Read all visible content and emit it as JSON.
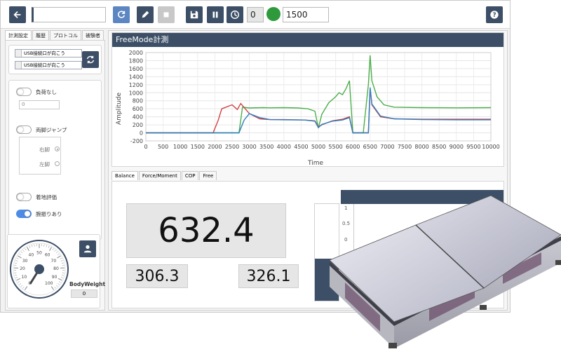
{
  "toolbar": {
    "field_value": "",
    "counter_value": "0",
    "duration_value": "1500",
    "indicator_color": "#2e9a3c"
  },
  "left_tabs": [
    "計測設定",
    "履歴",
    "プロトコル",
    "被験者"
  ],
  "usb_ports": [
    "USB接続口が向こう",
    "USB接続口が向こう"
  ],
  "settings": {
    "no_load_label": "負荷なし",
    "no_load_value": "0",
    "double_jump_label": "両脚ジャンプ",
    "right_leg_label": "右脚",
    "left_leg_label": "左脚",
    "landing_label": "着地評価",
    "arm_swing_label": "腕振りあり"
  },
  "gauge": {
    "ticks": [
      "0",
      "10",
      "20",
      "30",
      "40",
      "50",
      "60",
      "70",
      "80",
      "90",
      "100"
    ],
    "bodyweight_label": "BodyWeight",
    "bodyweight_value": "0"
  },
  "chart": {
    "title": "FreeMode計測",
    "ylabel": "Amplitude",
    "xlabel": "Time"
  },
  "chart_data": {
    "type": "line",
    "ylim": [
      -200,
      2000
    ],
    "xlim": [
      0,
      10000
    ],
    "yticks": [
      -200,
      0,
      200,
      400,
      600,
      800,
      1000,
      1200,
      1400,
      1600,
      1800,
      2000
    ],
    "xticks": [
      0,
      500,
      1000,
      1500,
      2000,
      2500,
      3000,
      3500,
      4000,
      4500,
      5000,
      5500,
      6000,
      6500,
      7000,
      7500,
      8000,
      8500,
      9000,
      9500,
      10000
    ],
    "grid": true,
    "series": [
      {
        "color": "#4cae4c",
        "x": [
          0,
          1950,
          2050,
          2200,
          2400,
          2700,
          2800,
          3000,
          3400,
          3600,
          4000,
          4400,
          4700,
          4900,
          5000,
          5100,
          5300,
          5500,
          5600,
          5700,
          5800,
          5900,
          6000,
          6100,
          6300,
          6450,
          6500,
          6550,
          6700,
          6900,
          7200,
          8000,
          9000,
          10000
        ],
        "y": [
          0,
          0,
          0,
          0,
          0,
          0,
          640,
          620,
          630,
          625,
          630,
          620,
          600,
          540,
          120,
          460,
          750,
          900,
          1000,
          950,
          1100,
          1300,
          0,
          0,
          0,
          1200,
          1930,
          1300,
          900,
          700,
          640,
          630,
          625,
          630
        ]
      },
      {
        "color": "#d04040",
        "x": [
          0,
          1950,
          2100,
          2200,
          2500,
          2650,
          2750,
          3000,
          3300,
          3600,
          4000,
          4600,
          4900,
          5000,
          5100,
          5400,
          5700,
          5900,
          6000,
          6100,
          6450,
          6500,
          6550,
          6800,
          7200,
          8000,
          9000,
          10000
        ],
        "y": [
          0,
          0,
          320,
          600,
          700,
          580,
          730,
          480,
          350,
          330,
          330,
          320,
          300,
          150,
          200,
          300,
          340,
          400,
          0,
          0,
          0,
          1100,
          700,
          400,
          350,
          340,
          340,
          340
        ]
      },
      {
        "color": "#2f7fc1",
        "x": [
          0,
          1950,
          2700,
          2850,
          3000,
          3300,
          3600,
          4000,
          4600,
          4900,
          5000,
          5100,
          5400,
          5700,
          5900,
          6000,
          6100,
          6450,
          6500,
          6550,
          6800,
          7200,
          8000,
          9000,
          10000
        ],
        "y": [
          0,
          0,
          0,
          320,
          480,
          380,
          330,
          325,
          320,
          290,
          130,
          210,
          290,
          320,
          380,
          0,
          0,
          0,
          1130,
          720,
          420,
          350,
          330,
          325,
          325
        ]
      }
    ]
  },
  "balance_tabs": [
    "Balance",
    "Force/Moment",
    "COP",
    "Free"
  ],
  "balance": {
    "total": "632.4",
    "left": "306.3",
    "right": "326.1"
  },
  "mini_chart": {
    "yticks": [
      "1",
      "0.5",
      "0",
      "-0"
    ]
  }
}
